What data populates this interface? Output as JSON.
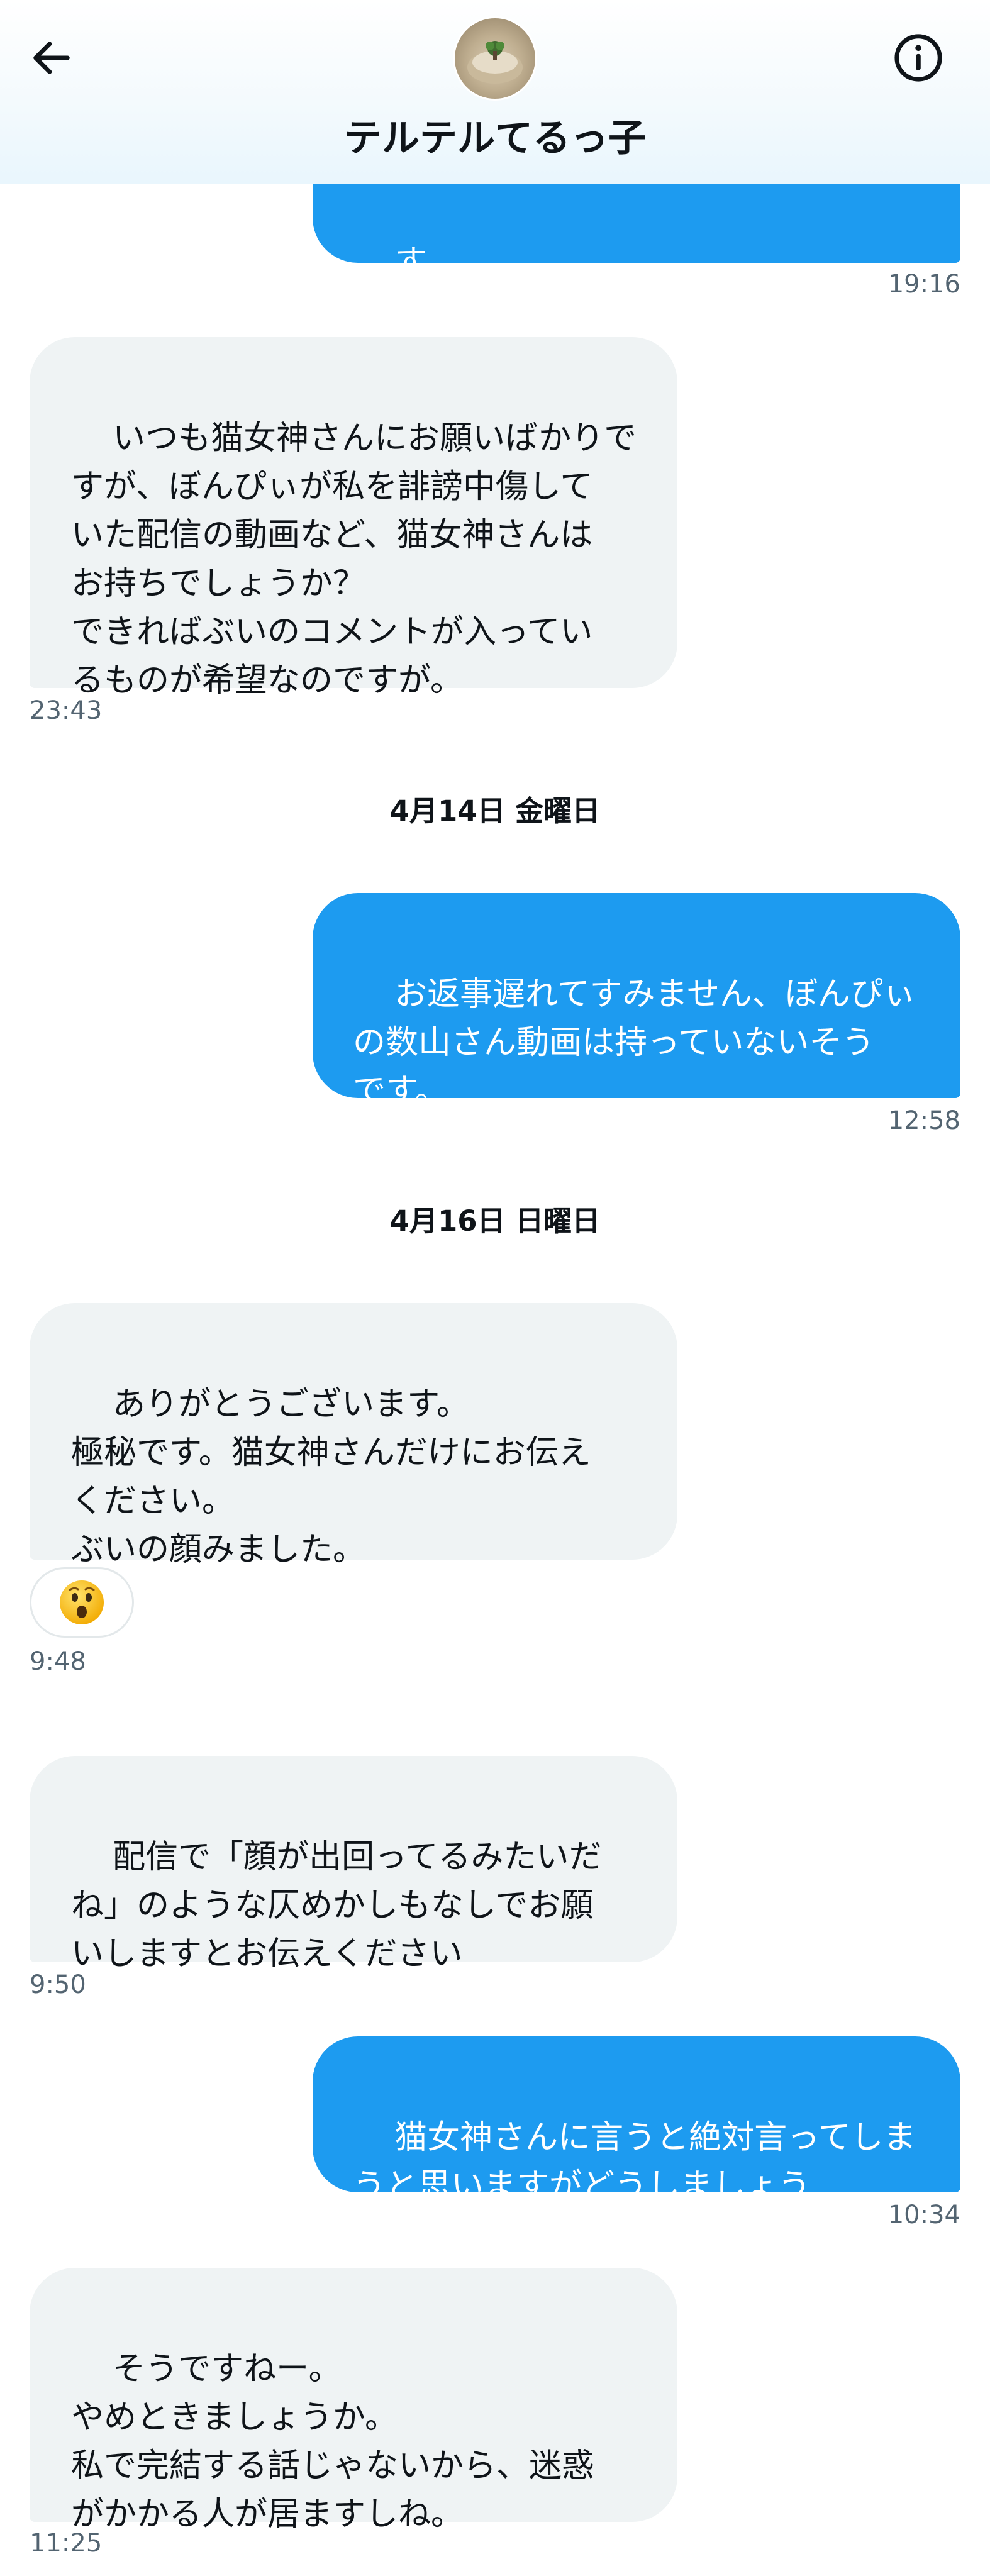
{
  "header": {
    "contact_name": "テルテルてるっ子",
    "back_icon": "arrow-left-icon",
    "info_icon": "info-circle-icon"
  },
  "messages": [
    {
      "direction": "out",
      "text": "す",
      "time": "19:16"
    },
    {
      "direction": "in",
      "text": "いつも猫女神さんにお願いばかりで\nすが、ぼんぴぃが私を誹謗中傷して\nいた配信の動画など、猫女神さんは\nお持ちでしょうか？\nできればぶいのコメントが入ってい\nるものが希望なのですが。",
      "time": "23:43"
    },
    {
      "direction": "out",
      "text": "お返事遅れてすみません、ぼんぴぃ\nの数山さん動画は持っていないそう\nです。",
      "time": "12:58"
    },
    {
      "direction": "in",
      "text": "ありがとうございます。\n極秘です。猫女神さんだけにお伝え\nください。\nぶいの顔みました。",
      "reaction": "astonished-face-emoji",
      "time": "9:48"
    },
    {
      "direction": "in",
      "text": "配信で「顔が出回ってるみたいだ\nね」のような仄めかしもなしでお願\nいしますとお伝えください",
      "time": "9:50"
    },
    {
      "direction": "out",
      "text": "猫女神さんに言うと絶対言ってしま\nうと思いますがどうしましょう",
      "time": "10:34"
    },
    {
      "direction": "in",
      "text": "そうですねー。\nやめときましょうか。\n私で完結する話じゃないから、迷惑\nがかかる人が居ますしね。",
      "time": "11:25"
    }
  ],
  "date_separators": [
    "4月14日 金曜日",
    "4月16日 日曜日"
  ],
  "colors": {
    "outgoing_bubble": "#1d9bf0",
    "incoming_bubble": "#eff3f4",
    "timestamp": "#536471",
    "text": "#0f1419"
  }
}
